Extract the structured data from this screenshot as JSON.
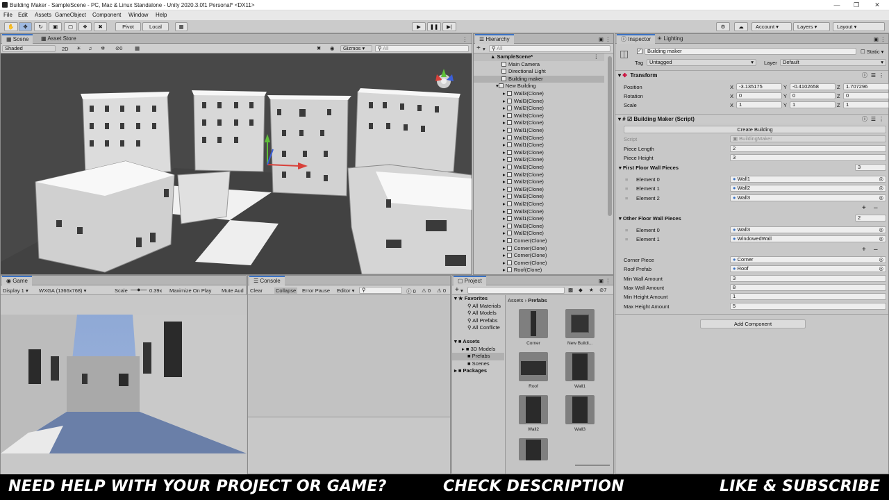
{
  "window": {
    "title": "Building Maker - SampleScene - PC, Mac & Linux Standalone - Unity 2020.3.0f1 Personal* <DX11>"
  },
  "menu": [
    "File",
    "Edit",
    "Assets",
    "GameObject",
    "Component",
    "Window",
    "Help"
  ],
  "toolbar": {
    "pivot": "Pivot",
    "local": "Local",
    "account": "Account",
    "layers": "Layers",
    "layout": "Layout"
  },
  "scene": {
    "tabs": [
      "Scene",
      "Asset Store"
    ],
    "shading": "Shaded",
    "mode2d": "2D",
    "hidden_count": "0",
    "gizmos": "Gizmos",
    "search_placeholder": "All"
  },
  "game": {
    "tab": "Game",
    "display": "Display 1",
    "resolution": "WXGA (1366x768)",
    "scale_label": "Scale",
    "scale_value": "0.39x",
    "maximize": "Maximize On Play",
    "mute": "Mute Aud"
  },
  "console": {
    "tab": "Console",
    "clear": "Clear",
    "collapse": "Collapse",
    "error_pause": "Error Pause",
    "editor": "Editor",
    "counts": [
      "0",
      "0",
      "0"
    ]
  },
  "hierarchy": {
    "tab": "Hierarchy",
    "search_placeholder": "All",
    "scene_name": "SampleScene*",
    "top_items": [
      "Main Camera",
      "Directional Light",
      "Building maker",
      "New Building"
    ],
    "children": [
      "Wall3(Clone)",
      "Wall3(Clone)",
      "Wall2(Clone)",
      "Wall3(Clone)",
      "Wall2(Clone)",
      "Wall1(Clone)",
      "Wall3(Clone)",
      "Wall1(Clone)",
      "Wall2(Clone)",
      "Wall2(Clone)",
      "Wall2(Clone)",
      "Wall2(Clone)",
      "Wall2(Clone)",
      "Wall3(Clone)",
      "Wall2(Clone)",
      "Wall2(Clone)",
      "Wall3(Clone)",
      "Wall1(Clone)",
      "Wall3(Clone)",
      "Wall2(Clone)",
      "Corner(Clone)",
      "Corner(Clone)",
      "Corner(Clone)",
      "Corner(Clone)",
      "Roof(Clone)"
    ]
  },
  "project": {
    "tab": "Project",
    "favorites": "Favorites",
    "fav_items": [
      "All Materials",
      "All Models",
      "All Prefabs",
      "All Conflicte"
    ],
    "assets": "Assets",
    "asset_folders": [
      "3D Models",
      "Prefabs",
      "Scenes"
    ],
    "packages": "Packages",
    "breadcrumb_root": "Assets",
    "breadcrumb_sep": "›",
    "breadcrumb_current": "Prefabs",
    "prefabs": [
      "Corner",
      "New Buildi...",
      "Roof",
      "Wall1",
      "Wall2",
      "Wall3",
      ""
    ]
  },
  "inspector": {
    "tabs": [
      "Inspector",
      "Lighting"
    ],
    "object_name": "Building maker",
    "static_label": "Static",
    "tag_label": "Tag",
    "tag_value": "Untagged",
    "layer_label": "Layer",
    "layer_value": "Default",
    "transform": {
      "title": "Transform",
      "position_label": "Position",
      "rotation_label": "Rotation",
      "scale_label": "Scale",
      "position": [
        "-3.135175",
        "-0.4102658",
        "1.707296"
      ],
      "rotation": [
        "0",
        "0",
        "0"
      ],
      "scale": [
        "1",
        "1",
        "1"
      ]
    },
    "script": {
      "title": "Building Maker (Script)",
      "create_button": "Create Building",
      "script_label": "Script",
      "script_value": "BuildingMaker",
      "piece_length_label": "Piece Length",
      "piece_length": "2",
      "piece_height_label": "Piece Height",
      "piece_height": "3",
      "first_floor_label": "First Floor Wall Pieces",
      "first_floor_count": "3",
      "first_floor": [
        {
          "label": "Element 0",
          "value": "Wall1"
        },
        {
          "label": "Element 1",
          "value": "Wall2"
        },
        {
          "label": "Element 2",
          "value": "Wall3"
        }
      ],
      "other_floor_label": "Other Floor Wall Pieces",
      "other_floor_count": "2",
      "other_floor": [
        {
          "label": "Element 0",
          "value": "Wall3"
        },
        {
          "label": "Element 1",
          "value": "WindowedWall"
        }
      ],
      "corner_label": "Corner Piece",
      "corner_value": "Corner",
      "roof_label": "Roof Prefab",
      "roof_value": "Roof",
      "min_wall_label": "Min Wall Amount",
      "min_wall": "3",
      "max_wall_label": "Max Wall Amount",
      "max_wall": "8",
      "min_height_label": "Min Height Amount",
      "min_height": "1",
      "max_height_label": "Max Height Amount",
      "max_height": "5"
    },
    "add_component": "Add Component"
  },
  "footer": {
    "left": "NEED HELP WITH YOUR PROJECT OR GAME?",
    "middle": "CHECK DESCRIPTION",
    "right": "LIKE & SUBSCRIBE"
  },
  "colors": {
    "accent": "#3a72c4",
    "scene_bg": "#474747",
    "sky_top": "#8fa9d6"
  }
}
